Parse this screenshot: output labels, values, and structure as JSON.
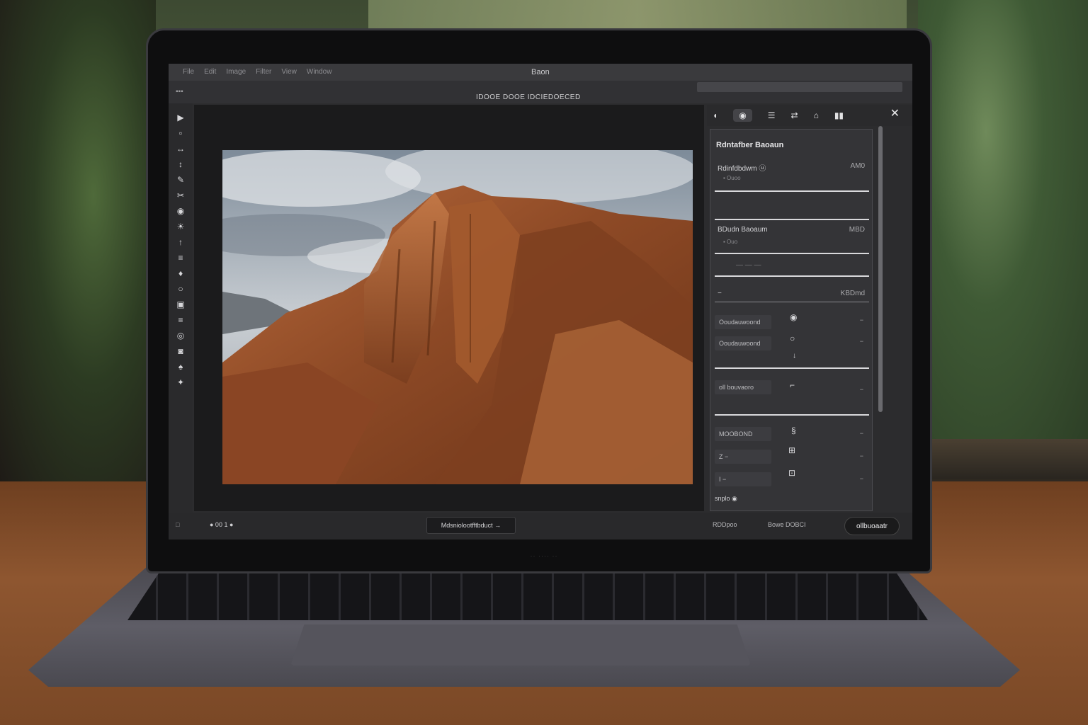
{
  "app": {
    "window_title": "Baon",
    "menu": [
      "File",
      "Edit",
      "Image",
      "Filter",
      "View",
      "Window"
    ],
    "doc_path": "IDOOE DOOE  IDCIEDOECED",
    "toolbar_left": "▪▪▪"
  },
  "tools": [
    "▶",
    "▫",
    "↔",
    "↕",
    "✎",
    "✂",
    "◉",
    "☀",
    "↑",
    "≡",
    "♦",
    "○",
    "▣",
    "≡",
    "◎",
    "◙",
    "♠",
    "✦"
  ],
  "panel": {
    "tabs": [
      "◖",
      "◉",
      "☰",
      "⇄",
      "⌂",
      "▮▮"
    ],
    "title": "Rdntafber  Baoaun",
    "sections": [
      {
        "label": "Rdinfdbdwm  ⓤ",
        "value": "AM0",
        "sub": "▪ Ouoo"
      },
      {
        "label": "BDudn Baoaum",
        "value": "MBD",
        "sub": "▪ Ouo"
      },
      {
        "label": "—  —  —",
        "value": "",
        "sub": ""
      },
      {
        "label": "−",
        "value": "KBDmd",
        "sub": ""
      }
    ],
    "rows": [
      {
        "field": "Ooudauwoond",
        "value": "−"
      },
      {
        "field": "Ooudauwoond",
        "value": "−"
      },
      {
        "field": "oll bouvaoro",
        "value": "−"
      },
      {
        "field": "MOOBOND",
        "value": "−"
      },
      {
        "field": "Z −",
        "value": "−"
      },
      {
        "field": "I  −",
        "value": "−"
      }
    ],
    "footer": "snplo  ◉"
  },
  "status": {
    "left": "□",
    "zoom": "● 00  1 ●",
    "center": "Mdsniolootfftbduct →",
    "r1": "RDDpoo",
    "r2": "Bowe  DOBCI",
    "action": "ollbuoaatr"
  }
}
